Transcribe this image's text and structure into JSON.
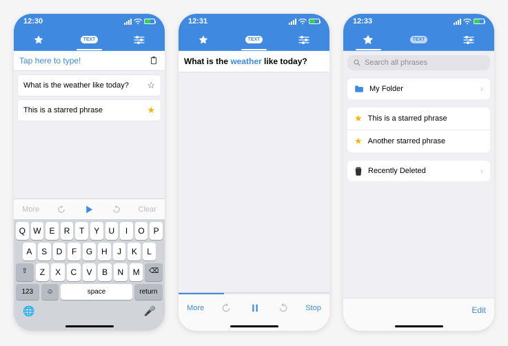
{
  "screens": [
    {
      "status_time": "12:30",
      "tabs": {
        "active": "text"
      },
      "input_placeholder": "Tap here to type!",
      "phrases": [
        {
          "text": "What is the weather like today?",
          "starred": false
        },
        {
          "text": "This is a starred phrase",
          "starred": true
        }
      ],
      "playbar": {
        "more": "More",
        "clear": "Clear"
      },
      "keyboard": {
        "row1": [
          "Q",
          "W",
          "E",
          "R",
          "T",
          "Y",
          "U",
          "I",
          "O",
          "P"
        ],
        "row2": [
          "A",
          "S",
          "D",
          "F",
          "G",
          "H",
          "J",
          "K",
          "L"
        ],
        "row3": [
          "⇧",
          "Z",
          "X",
          "C",
          "V",
          "B",
          "N",
          "M",
          "⌫"
        ],
        "row4": {
          "num": "123",
          "emoji": "☺",
          "space": "space",
          "ret": "return"
        }
      }
    },
    {
      "status_time": "12:31",
      "tabs": {
        "active": "text"
      },
      "speaking": {
        "prefix": "What is the ",
        "highlight": "weather",
        "suffix": " like today?"
      },
      "playbar": {
        "more": "More",
        "stop": "Stop"
      }
    },
    {
      "status_time": "12:33",
      "tabs": {
        "active": "star"
      },
      "search_placeholder": "Search all phrases",
      "folder": "My Folder",
      "starred": [
        "This is a starred phrase",
        "Another starred phrase"
      ],
      "deleted_label": "Recently Deleted",
      "edit_label": "Edit"
    }
  ]
}
